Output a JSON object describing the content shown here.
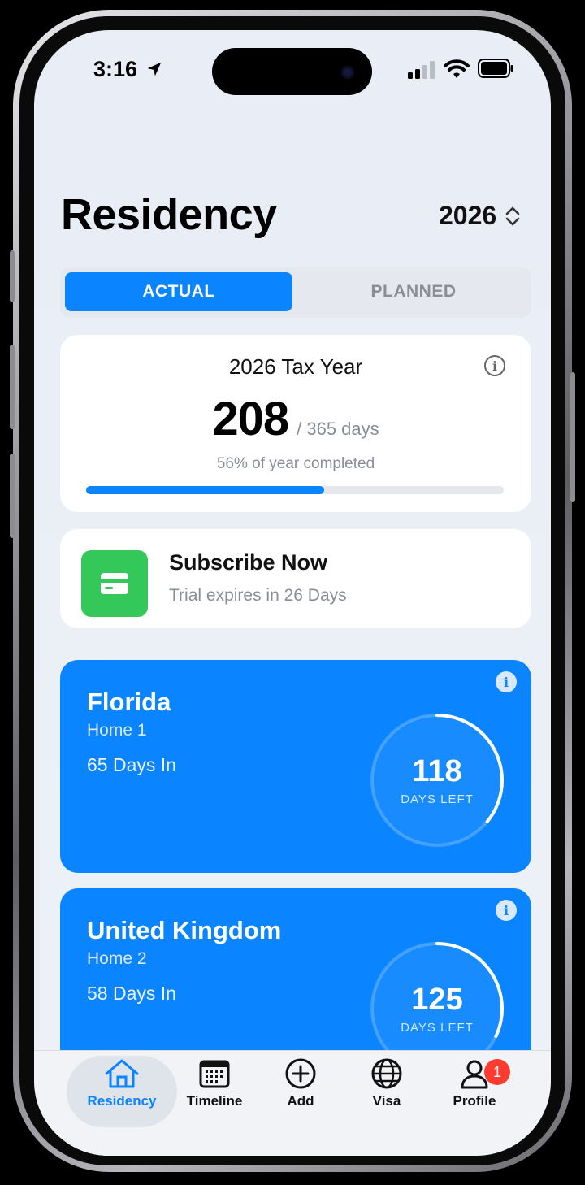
{
  "status_bar": {
    "time": "3:16"
  },
  "header": {
    "title": "Residency",
    "year": "2026"
  },
  "segmented": {
    "actual": "ACTUAL",
    "planned": "PLANNED",
    "selected": "ACTUAL"
  },
  "tax_card": {
    "title": "2026 Tax Year",
    "days": "208",
    "days_total": "/ 365 days",
    "percent_text": "56% of year completed",
    "progress_fraction": 0.57
  },
  "subscribe": {
    "title": "Subscribe Now",
    "subtitle": "Trial expires in 26 Days"
  },
  "residences": [
    {
      "name": "Florida",
      "home": "Home 1",
      "days_in": "65 Days In",
      "days_left": "118",
      "days_left_label": "DAYS LEFT",
      "ring_fraction": 0.36
    },
    {
      "name": "United Kingdom",
      "home": "Home 2",
      "days_in": "58 Days In",
      "days_left": "125",
      "days_left_label": "DAYS LEFT",
      "ring_fraction": 0.32
    }
  ],
  "tabs": [
    {
      "label": "Residency",
      "icon": "house-icon",
      "active": true
    },
    {
      "label": "Timeline",
      "icon": "calendar-icon",
      "active": false
    },
    {
      "label": "Add",
      "icon": "plus-circle-icon",
      "active": false
    },
    {
      "label": "Visa",
      "icon": "globe-icon",
      "active": false
    },
    {
      "label": "Profile",
      "icon": "person-icon",
      "active": false,
      "badge": "1"
    }
  ],
  "colors": {
    "accent": "#0a84ff",
    "subscribe_green": "#34c759",
    "badge_red": "#ff3b30"
  }
}
